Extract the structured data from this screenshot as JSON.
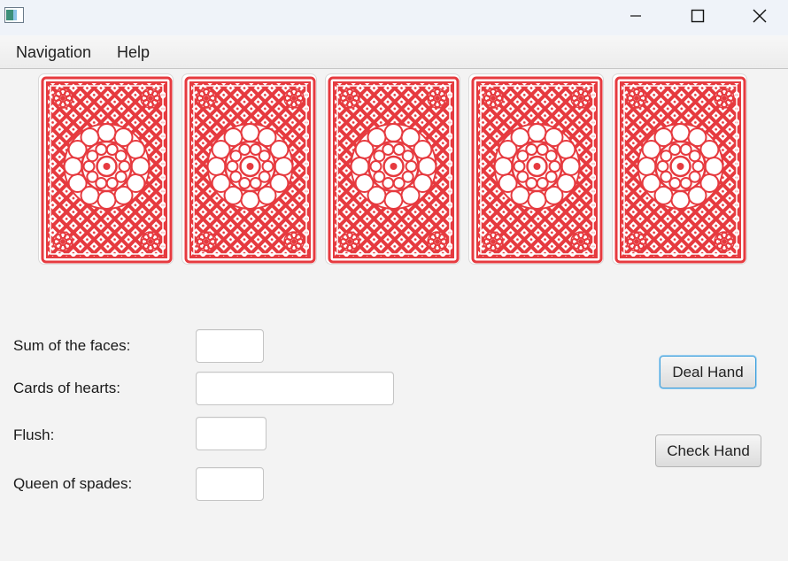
{
  "window": {
    "controls": {
      "minimize_icon": "minimize-icon",
      "maximize_icon": "maximize-icon",
      "close_icon": "close-icon"
    }
  },
  "menubar": {
    "items": [
      {
        "label": "Navigation"
      },
      {
        "label": "Help"
      }
    ]
  },
  "cards": {
    "count": 5,
    "face": "back",
    "color": "#e63a3f"
  },
  "form": {
    "sum_of_faces": {
      "label": "Sum of the faces:",
      "value": ""
    },
    "cards_of_hearts": {
      "label": "Cards of hearts:",
      "value": ""
    },
    "flush": {
      "label": "Flush:",
      "value": ""
    },
    "queen_of_spades": {
      "label": "Queen of spades:",
      "value": ""
    }
  },
  "actions": {
    "deal_label": "Deal Hand",
    "check_label": "Check Hand"
  },
  "colors": {
    "accent": "#3c9fdc",
    "card_red": "#e63a3f"
  }
}
